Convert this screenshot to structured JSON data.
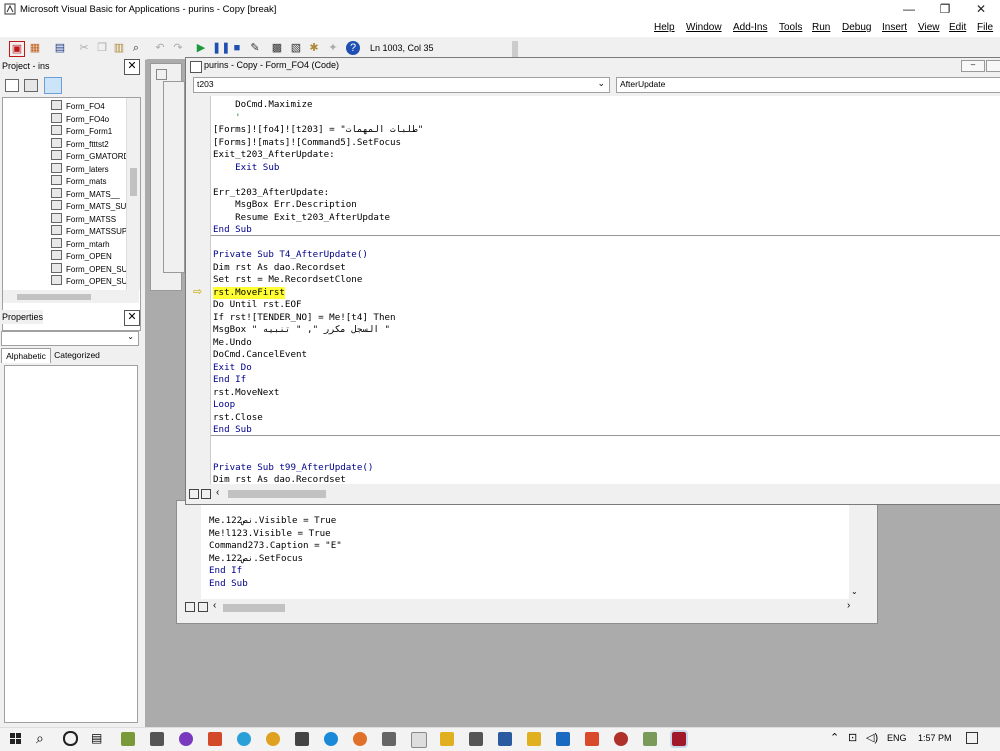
{
  "window": {
    "title": "Microsoft Visual Basic for Applications - purins - Copy [break]"
  },
  "menu": [
    "File",
    "Edit",
    "View",
    "Insert",
    "Debug",
    "Run",
    "Tools",
    "Add-Ins",
    "Window",
    "Help"
  ],
  "status": {
    "position": "Ln 1003, Col 35"
  },
  "project_pane": {
    "title": "Project - ins",
    "items": [
      "Form_FO4",
      "Form_FO4o",
      "Form_Form1",
      "Form_ftttst2",
      "Form_GMATORD",
      "Form_laters",
      "Form_mats",
      "Form_MATS__",
      "Form_MATS_SU",
      "Form_MATSS",
      "Form_MATSSUP_",
      "Form_mtarh",
      "Form_OPEN",
      "Form_OPEN_SU",
      "Form_OPEN_SU"
    ]
  },
  "properties_pane": {
    "title": "Properties",
    "tabs": [
      "Alphabetic",
      "Categorized"
    ]
  },
  "code_window": {
    "title": "purins - Copy - Form_FO4 (Code)",
    "object_combo": "t203",
    "proc_combo": "AfterUpdate",
    "lines": [
      {
        "text": "    DoCmd.Maximize",
        "kw": false
      },
      {
        "text": "    '",
        "kw": false
      },
      {
        "text": "[Forms]![fo4]![t203] = \"طلبات المهمات\"",
        "kw": false
      },
      {
        "text": "[Forms]![mats]![Command5].SetFocus",
        "kw": false
      },
      {
        "text": "Exit_t203_AfterUpdate:",
        "kw": false
      },
      {
        "text": "    Exit Sub",
        "kw": true
      },
      {
        "text": "",
        "kw": false
      },
      {
        "text": "Err_t203_AfterUpdate:",
        "kw": false
      },
      {
        "text": "    MsgBox Err.Description",
        "kw": false
      },
      {
        "text": "    Resume Exit_t203_AfterUpdate",
        "kw": false
      },
      {
        "text": "End Sub",
        "kw": true
      },
      {
        "text": "",
        "kw": false
      },
      {
        "text": "Private Sub T4_AfterUpdate()",
        "kw": true
      },
      {
        "text": "Dim rst As dao.Recordset",
        "kw": false
      },
      {
        "text": "Set rst = Me.RecordsetClone",
        "kw": false
      },
      {
        "text": "rst.MoveFirst",
        "kw": false
      },
      {
        "text": "Do Until rst.EOF",
        "kw": false
      },
      {
        "text": "If rst![TENDER_NO] = Me![t4] Then",
        "kw": false
      },
      {
        "text": "MsgBox \" السجل مكرر \", \" تنبيه \"",
        "kw": false
      },
      {
        "text": "Me.Undo",
        "kw": false
      },
      {
        "text": "DoCmd.CancelEvent",
        "kw": false
      },
      {
        "text": "Exit Do",
        "kw": true
      },
      {
        "text": "End If",
        "kw": true
      },
      {
        "text": "rst.MoveNext",
        "kw": false
      },
      {
        "text": "Loop",
        "kw": true
      },
      {
        "text": "rst.Close",
        "kw": false
      },
      {
        "text": "End Sub",
        "kw": true
      },
      {
        "text": "",
        "kw": false
      },
      {
        "text": "",
        "kw": false
      },
      {
        "text": "Private Sub t99_AfterUpdate()",
        "kw": true
      },
      {
        "text": "Dim rst As dao.Recordset",
        "kw": false
      }
    ]
  },
  "back_code": {
    "lines": [
      {
        "text": "Me.نص122.Visible = True",
        "kw": false
      },
      {
        "text": "Me!l123.Visible = True",
        "kw": false
      },
      {
        "text": "Command273.Caption = \"E\"",
        "kw": false
      },
      {
        "text": "Me.نص122.SetFocus",
        "kw": false
      },
      {
        "text": "End If",
        "kw": true
      },
      {
        "text": "End Sub",
        "kw": true
      }
    ]
  },
  "taskbar": {
    "lang": "ENG",
    "time": "1:57 PM"
  },
  "colors": {
    "highlight": "#ffff33",
    "keyword": "#00008b",
    "accent_red": "#c01818"
  }
}
